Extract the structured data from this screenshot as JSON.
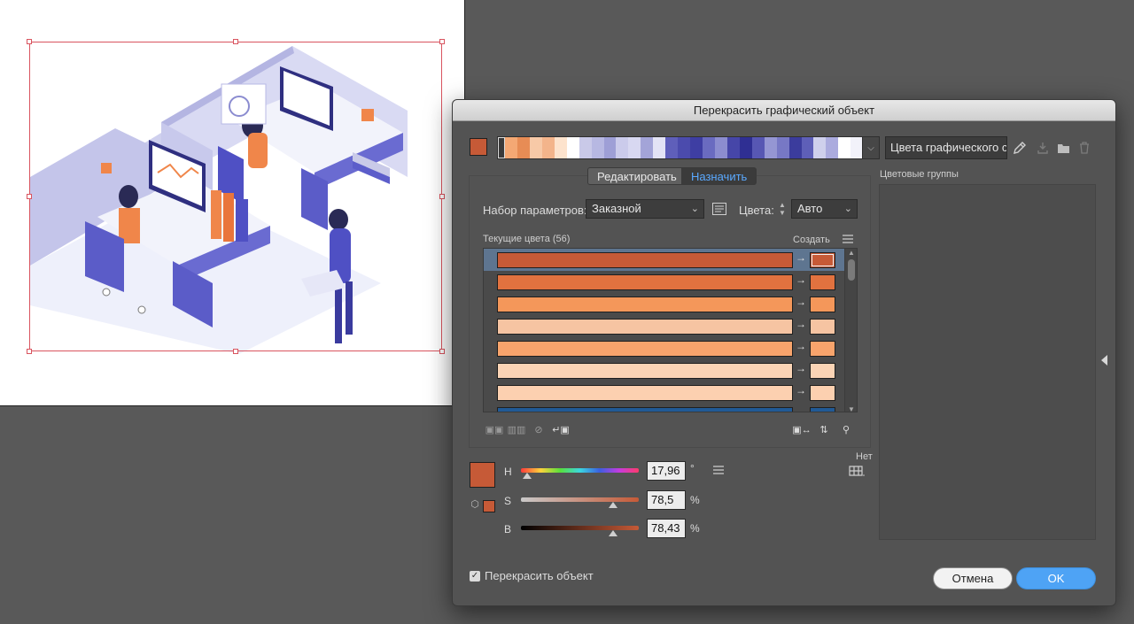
{
  "dialog": {
    "title": "Перекрасить графический объект",
    "active_color": "#c65a37",
    "harmony_colors": [
      "#3a3a3a",
      "#f4a874",
      "#e78c55",
      "#f7c9a7",
      "#f3b48b",
      "#fde3cd",
      "#ffffff",
      "#c9c9e8",
      "#b7b8e2",
      "#9e9fd6",
      "#cbcbeb",
      "#d8d8f1",
      "#a3a4d8",
      "#e3e3f5",
      "#5f5fba",
      "#4b4bad",
      "#3e3ea3",
      "#6a6bc0",
      "#8c8dcf",
      "#4646a8",
      "#2f2f93",
      "#5757b3",
      "#9596d3",
      "#7778c5",
      "#3b3c9d",
      "#5e5fb8",
      "#cfd0ec",
      "#ababde",
      "#ffffff",
      "#f2f2fa"
    ],
    "color_group_name": "Цвета графического с",
    "tabs": {
      "edit": "Редактировать",
      "assign": "Назначить"
    },
    "preset_label": "Набор параметров:",
    "preset_value": "Заказной",
    "colors_label": "Цвета:",
    "colors_value": "Авто",
    "current_colors_label": "Текущие цвета (56)",
    "create_label": "Создать",
    "color_rows": [
      {
        "current": "#c65a37",
        "new": "#c65a37",
        "selected": true
      },
      {
        "current": "#e2723f",
        "new": "#e2723f",
        "selected": false
      },
      {
        "current": "#f4975a",
        "new": "#f4975a",
        "selected": false
      },
      {
        "current": "#f6c4a2",
        "new": "#f6c4a2",
        "selected": false
      },
      {
        "current": "#f8a46c",
        "new": "#f8a46c",
        "selected": false
      },
      {
        "current": "#fbd4b5",
        "new": "#fbd4b5",
        "selected": false
      },
      {
        "current": "#fcd0b0",
        "new": "#fcd0b0",
        "selected": false
      },
      {
        "current": "#215a96",
        "new": "#215a96",
        "selected": false
      }
    ],
    "none_label": "Нет",
    "hsb": {
      "h_label": "H",
      "h_value": "17,96",
      "h_unit": "°",
      "h_fraction": 0.05,
      "s_label": "S",
      "s_value": "78,5",
      "s_unit": "%",
      "s_fraction": 0.785,
      "b_label": "B",
      "b_value": "78,43",
      "b_unit": "%",
      "b_fraction": 0.7843
    },
    "color_groups_label": "Цветовые группы",
    "recolor_label": "Перекрасить объект",
    "recolor_checked": true,
    "cancel_label": "Отмена",
    "ok_label": "OK"
  }
}
